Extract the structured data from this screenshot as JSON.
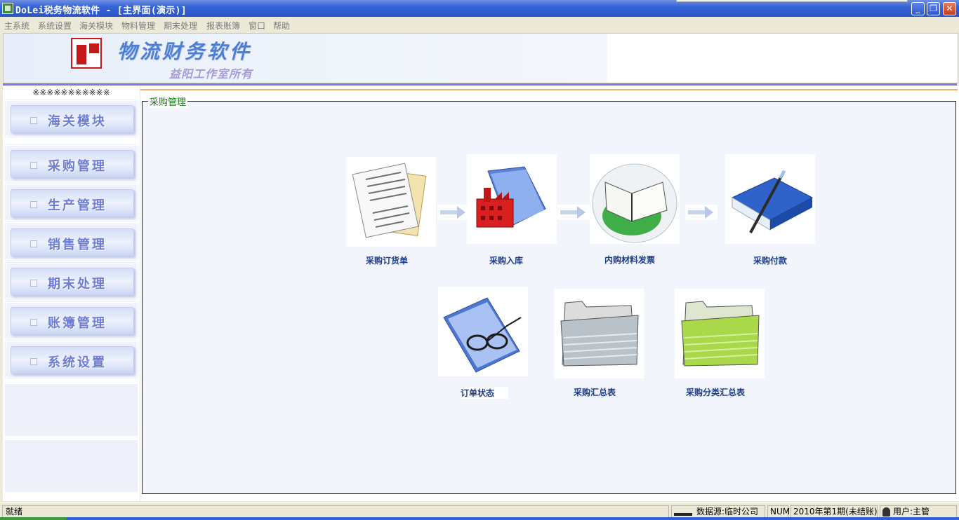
{
  "window": {
    "title": "DoLei税务物流软件 - [主界面(演示)]",
    "min_label": "_",
    "max_label": "❐",
    "close_label": "✕"
  },
  "menu": [
    "主系统",
    "系统设置",
    "海关模块",
    "物料管理",
    "期末处理",
    "报表账簿",
    "窗口",
    "帮助"
  ],
  "banner": {
    "title": "物流财务软件",
    "subtitle": "益阳工作室所有"
  },
  "sidebar": {
    "header": "※※※※※※※※※※※",
    "items": [
      "海关模块",
      "采购管理",
      "生产管理",
      "销售管理",
      "期末处理",
      "账簿管理",
      "系统设置"
    ]
  },
  "main": {
    "group_title": "采购管理",
    "tiles": [
      {
        "label": "采购订货单",
        "icon": "document-icon"
      },
      {
        "label": "采购入库",
        "icon": "factory-folder-icon"
      },
      {
        "label": "内购材料发票",
        "icon": "open-book-icon"
      },
      {
        "label": "采购付款",
        "icon": "binder-pen-icon"
      },
      {
        "label": "订单状态",
        "icon": "folder-glasses-icon"
      },
      {
        "label": "采购汇总表",
        "icon": "gray-folder-icon"
      },
      {
        "label": "采购分类汇总表",
        "icon": "green-folder-icon"
      }
    ]
  },
  "status": {
    "ready": "就绪",
    "datasource": "数据源:临时公司",
    "num": "NUM",
    "period": "2010年第1期(未结账)",
    "user": "用户:主管"
  },
  "colors": {
    "titlebar": "#2a55c8",
    "accent_line": "#7f7be0",
    "group_title": "#147a14",
    "tile_label": "#1c3c8c",
    "side_label": "#6d7dd6"
  }
}
